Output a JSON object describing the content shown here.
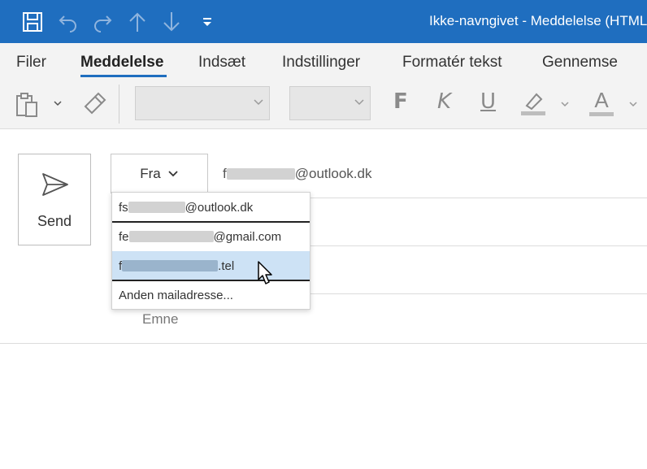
{
  "title_bar": {
    "window_title": "Ikke-navngivet  -  Meddelelse (HTML)",
    "quick_access": [
      "save-icon",
      "undo-icon",
      "redo-icon",
      "up-arrow-icon",
      "down-arrow-icon",
      "customize-dropdown-icon"
    ],
    "color": "#1f6ebf"
  },
  "ribbon": {
    "tabs": [
      "Filer",
      "Meddelelse",
      "Indsæt",
      "Indstillinger",
      "Formatér tekst",
      "Gennemse"
    ],
    "active_tab": "Meddelelse",
    "format_buttons": {
      "bold": "F",
      "italic": "K",
      "underline": "U",
      "font_color": "A"
    }
  },
  "compose": {
    "send_label": "Send",
    "from_label": "Fra",
    "from_value_prefix": "f",
    "from_value_suffix": "@outlook.dk",
    "subject_label": "Emne"
  },
  "dropdown": {
    "items": [
      {
        "prefix": "fs",
        "suffix": "@outlook.dk"
      },
      {
        "prefix": "fe",
        "suffix": "@gmail.com"
      },
      {
        "prefix": "f",
        "suffix": ".tel",
        "hovered": true
      },
      {
        "label": "Anden mailadresse..."
      }
    ],
    "hover_color": "#cde2f5"
  }
}
